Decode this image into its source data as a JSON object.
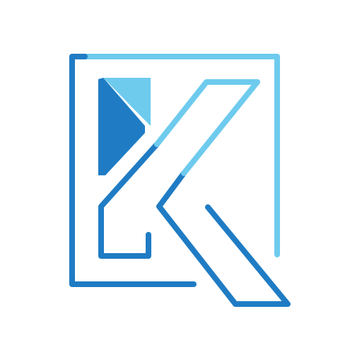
{
  "logo": {
    "icon": "k-monogram-logo-icon",
    "colors": {
      "dark_blue": "#1f7cc4",
      "light_blue": "#6ecbee",
      "background": "#ffffff"
    }
  }
}
